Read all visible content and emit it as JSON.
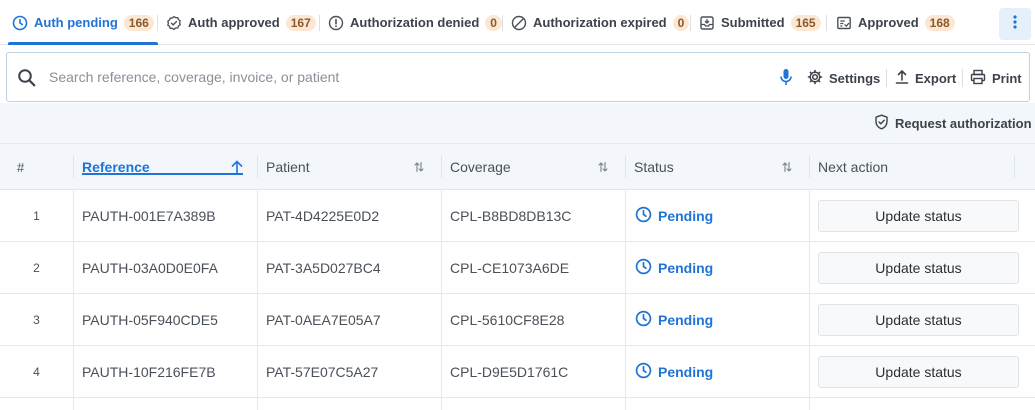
{
  "tabs": [
    {
      "label": "Auth pending",
      "count": "166",
      "icon": "clock-icon",
      "active": true
    },
    {
      "label": "Auth approved",
      "count": "167",
      "icon": "badge-check-icon"
    },
    {
      "label": "Authorization denied",
      "count": "0",
      "icon": "alert-circle-icon"
    },
    {
      "label": "Authorization expired",
      "count": "0",
      "icon": "ban-icon"
    },
    {
      "label": "Submitted",
      "count": "165",
      "icon": "inbox-icon"
    },
    {
      "label": "Approved",
      "count": "168",
      "icon": "document-check-icon"
    }
  ],
  "search": {
    "placeholder": "Search reference, coverage, invoice, or patient"
  },
  "toolbar": {
    "settings": "Settings",
    "export": "Export",
    "print": "Print"
  },
  "actions": {
    "request_authorization": "Request authorization"
  },
  "table": {
    "columns": {
      "num": "#",
      "reference": "Reference",
      "patient": "Patient",
      "coverage": "Coverage",
      "status": "Status",
      "next_action": "Next action"
    },
    "rows": [
      {
        "num": "1",
        "reference": "PAUTH-001E7A389B",
        "patient": "PAT-4D4225E0D2",
        "coverage": "CPL-B8BD8DB13C",
        "status": "Pending",
        "action": "Update status"
      },
      {
        "num": "2",
        "reference": "PAUTH-03A0D0E0FA",
        "patient": "PAT-3A5D027BC4",
        "coverage": "CPL-CE1073A6DE",
        "status": "Pending",
        "action": "Update status"
      },
      {
        "num": "3",
        "reference": "PAUTH-05F940CDE5",
        "patient": "PAT-0AEA7E05A7",
        "coverage": "CPL-5610CF8E28",
        "status": "Pending",
        "action": "Update status"
      },
      {
        "num": "4",
        "reference": "PAUTH-10F216FE7B",
        "patient": "PAT-57E07C5A27",
        "coverage": "CPL-D9E5D1761C",
        "status": "Pending",
        "action": "Update status"
      }
    ]
  },
  "colors": {
    "accent": "#1f74d8",
    "badge_bg": "#fbe7d3",
    "header_bg": "#f3f7fb"
  }
}
